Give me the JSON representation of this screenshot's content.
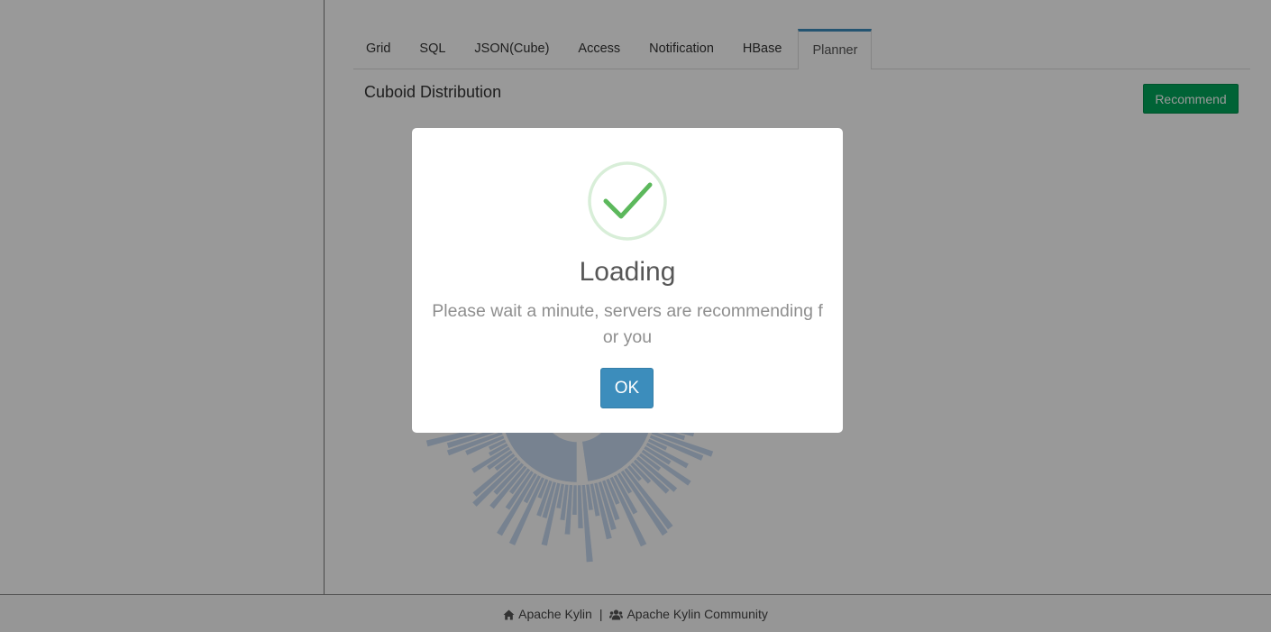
{
  "tabs": [
    {
      "label": "Grid"
    },
    {
      "label": "SQL"
    },
    {
      "label": "JSON(Cube)"
    },
    {
      "label": "Access"
    },
    {
      "label": "Notification"
    },
    {
      "label": "HBase"
    },
    {
      "label": "Planner"
    }
  ],
  "active_tab": "Planner",
  "planner": {
    "title": "Cuboid Distribution",
    "recommend_label": "Recommend"
  },
  "footer": {
    "home_link": "Apache Kylin",
    "separator": "|",
    "community_link": "Apache Kylin Community"
  },
  "modal": {
    "icon": "success-check-icon",
    "title": "Loading",
    "text": "Please wait a minute, servers are recommending for you",
    "ok_label": "OK"
  },
  "colors": {
    "success": "#00a65a",
    "primary": "#3c8dbc",
    "check": "#5cb85c",
    "sunburst": "#c6d9f0"
  }
}
